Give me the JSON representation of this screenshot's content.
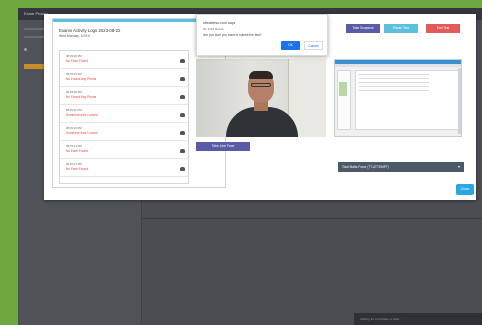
{
  "app": {
    "title": "Exam Proctor",
    "bottom_status": "Waiting for Candidate to Start..."
  },
  "modal": {
    "title": "Exams Activity Logs 2023-08-22",
    "subtitle": "Wed Monday, 1:00:0",
    "log_items": [
      {
        "time": "08:45:00 PM",
        "event": "No Face Found"
      },
      {
        "time": "08:45:01 PM",
        "event": "No Found Any Phone"
      },
      {
        "time": "08:45:05 PM",
        "event": "No Found Any Phone"
      },
      {
        "time": "08:45:11 PM",
        "event": "Someone else Looked"
      },
      {
        "time": "08:45:16 PM",
        "event": "Someone else Looked"
      },
      {
        "time": "08:45:21 PM",
        "event": "No Face Found"
      },
      {
        "time": "08:45:27 PM",
        "event": "No Face Found"
      }
    ],
    "take_live_face_label": "Take Live Face",
    "take_snapshot_label": "Take Snapshot",
    "pause_label": "Pause Test",
    "end_label": "End Test",
    "attempt_label": "Total Mafia Force (TT-ATTEMPT)",
    "close_label": "Close"
  },
  "confirm": {
    "site": "sitealdesu.com says",
    "sub": "ID: 1124 Result",
    "message": "Are you sure you want to submit the test?",
    "ok_label": "OK",
    "cancel_label": "Cancel"
  }
}
